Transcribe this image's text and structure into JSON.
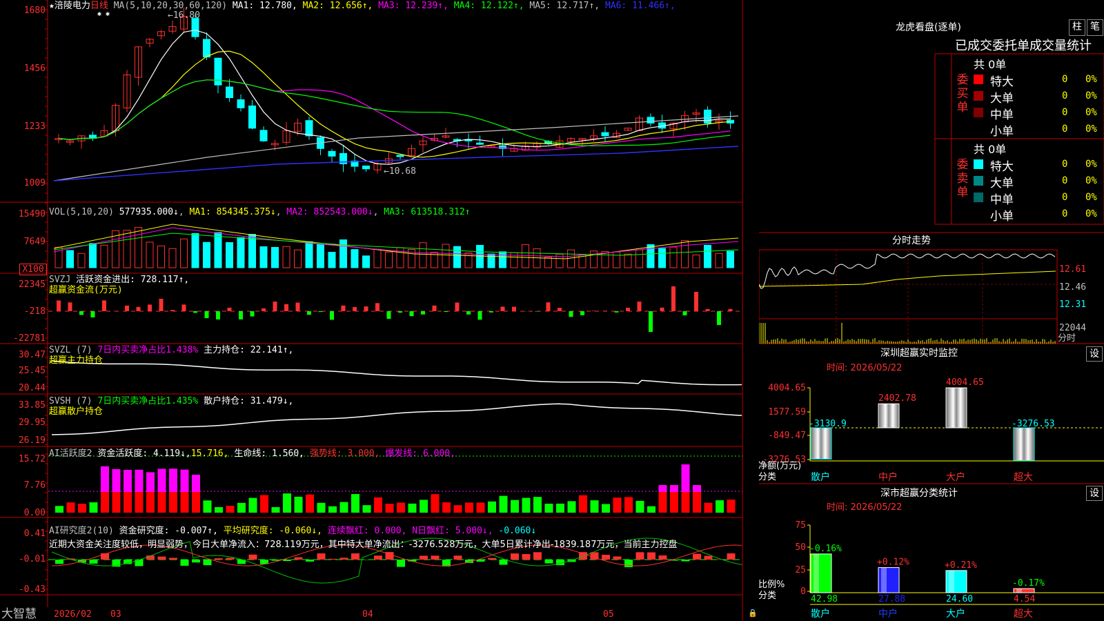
{
  "stock": {
    "star": "★",
    "name": "涪陵电力",
    "period": "日线",
    "ma_label": "MA(5,10,20,30,60,120)",
    "ma": [
      {
        "t": "MA1: 12.780",
        "c": "#ffffff"
      },
      {
        "t": "MA2: 12.656↑",
        "c": "#ffff00"
      },
      {
        "t": "MA3: 12.239↑",
        "c": "#ff00ff"
      },
      {
        "t": "MA4: 12.122↑",
        "c": "#00ff00"
      },
      {
        "t": "MA5: 12.717↑",
        "c": "#c0c0c0"
      },
      {
        "t": "MA6: 11.466↑",
        "c": "#3030ff"
      }
    ],
    "high_mark": "←16.80",
    "low_mark": "←10.68",
    "stars": "✱ ✱"
  },
  "colors": {
    "up": "#ff3030",
    "down": "#00ffff",
    "green": "#00ff00",
    "magenta": "#ff00ff",
    "yellow": "#ffff00",
    "grid": "#b00000"
  },
  "axes": {
    "price": [
      "1680",
      "1456",
      "1233",
      "1009"
    ],
    "vol": [
      "15490",
      "7649",
      "X100"
    ],
    "svzj": [
      "22345",
      "-218",
      "-22781"
    ],
    "svzl": [
      "30.47",
      "25.45",
      "20.44"
    ],
    "svsh": [
      "33.85",
      "29.95",
      "26.19"
    ],
    "ai1": [
      "15.72",
      "7.76",
      "0.00"
    ],
    "ai2": [
      "0.41",
      "-0.01",
      "-0.43"
    ]
  },
  "vol_header": {
    "label": "VOL(5,10,20)",
    "value": "577935.000↓",
    "ma1": "MA1: 854345.375↓",
    "ma2": "MA2: 852543.000↓",
    "ma3": "MA3: 613518.312↑"
  },
  "svzj_header": {
    "label": "SVZJ",
    "text": "活跃资金进出: 728.117↑,",
    "sub": "超赢资金流(万元)"
  },
  "svzl_header": {
    "label": "SVZL (7)",
    "ratio": "7日内买卖净占比1.438%",
    "text": "主力持仓: 22.141↑,",
    "sub": "超赢主力持仓"
  },
  "svsh_header": {
    "label": "SVSH (7)",
    "ratio": "7日内买卖净占比1.435%",
    "text": "散户持仓: 31.479↓,",
    "sub": "超赢散户持仓"
  },
  "ai1_header": {
    "label": "AI活跃度2",
    "a": "资金活跃度: 4.119↓,",
    "b": "15.716,",
    "c": "生命线: 1.560,",
    "d": "强势线: 3.000,",
    "e": "爆发线: 6.000,"
  },
  "ai2_header": {
    "label": "AI研究度2(10)",
    "a": "资金研究度: -0.007↑,",
    "b": "平均研究度: -0.060↓,",
    "c": "连续飘红: 0.000,",
    "d": "N日飘红: 5.000↓,",
    "e": "-0.060↓"
  },
  "summary": "近期大资金关注度较低，明显弱势，今日大单净流入：728.119万元，其中特大单净流出：-3276.528万元，大单5日累计净出-1839.187万元，当前主力控盘",
  "dates": [
    "2026/02",
    "03",
    "04",
    "05"
  ],
  "brand": "大智慧",
  "dragon": {
    "title": "龙虎看盘(逐单)",
    "btn1": "柱",
    "btn2": "笔",
    "tabs": [
      "已成交",
      "委托单",
      "成交量统计"
    ],
    "buy": {
      "label": "委买单",
      "total": "共 0单",
      "rows": [
        {
          "n": "特大",
          "v": "0",
          "p": "0%",
          "c": "#ff0000"
        },
        {
          "n": "大单",
          "v": "0",
          "p": "0%",
          "c": "#a00000"
        },
        {
          "n": "中单",
          "v": "0",
          "p": "0%",
          "c": "#800000"
        },
        {
          "n": "小单",
          "v": "0",
          "p": "0%",
          "c": ""
        }
      ]
    },
    "sell": {
      "label": "委卖单",
      "total": "共 0单",
      "rows": [
        {
          "n": "特大",
          "v": "0",
          "p": "0%",
          "c": "#00ffff"
        },
        {
          "n": "大单",
          "v": "0",
          "p": "0%",
          "c": "#008888"
        },
        {
          "n": "中单",
          "v": "0",
          "p": "0%",
          "c": "#006868"
        },
        {
          "n": "小单",
          "v": "0",
          "p": "0%",
          "c": ""
        }
      ]
    }
  },
  "intraday": {
    "title": "分时走势",
    "prices": [
      "12.61",
      "12.46",
      "12.31"
    ],
    "vol": "22044",
    "vol_label": "分时"
  },
  "sz_monitor": {
    "title": "深圳超赢实时监控",
    "btn": "设",
    "time": "时间: 2026/05/22",
    "yaxis": [
      "4004.65",
      "1577.59",
      "-849.47",
      "-3276.53"
    ],
    "ylabel": "净额(万元)",
    "xlabel": "分类",
    "bars": [
      {
        "cat": "散户",
        "val": -3130.9,
        "label": "-3130.9",
        "lc": "#00ffff",
        "cc": "#00ffff"
      },
      {
        "cat": "中户",
        "val": 2402.78,
        "label": "2402.78",
        "lc": "#ff3030",
        "cc": "#ff3030"
      },
      {
        "cat": "大户",
        "val": 4004.65,
        "label": "4004.65",
        "lc": "#ff3030",
        "cc": "#ff3030"
      },
      {
        "cat": "超大",
        "val": -3276.53,
        "label": "-3276.53",
        "lc": "#00ffff",
        "cc": "#ff3030"
      }
    ]
  },
  "sz_class": {
    "title": "深市超赢分类统计",
    "btn": "设",
    "time": "时间: 2026/05/22",
    "yaxis": [
      "75",
      "50",
      "25",
      "0"
    ],
    "ylabel": "比例%",
    "xlabel": "分类",
    "bars": [
      {
        "cat": "散户",
        "val": 42.98,
        "chg": "-0.16%",
        "chgc": "#00ff00",
        "col": "#00ff00",
        "num": "42.98"
      },
      {
        "cat": "中户",
        "val": 27.88,
        "chg": "+0.12%",
        "chgc": "#ff3030",
        "col": "#2020ff",
        "num": "27.88"
      },
      {
        "cat": "大户",
        "val": 24.6,
        "chg": "+0.21%",
        "chgc": "#ff3030",
        "col": "#00ffff",
        "num": "24.60"
      },
      {
        "cat": "超大",
        "val": 4.54,
        "chg": "-0.17%",
        "chgc": "#00ff00",
        "col": "#ff3030",
        "num": "4.54"
      }
    ]
  }
}
